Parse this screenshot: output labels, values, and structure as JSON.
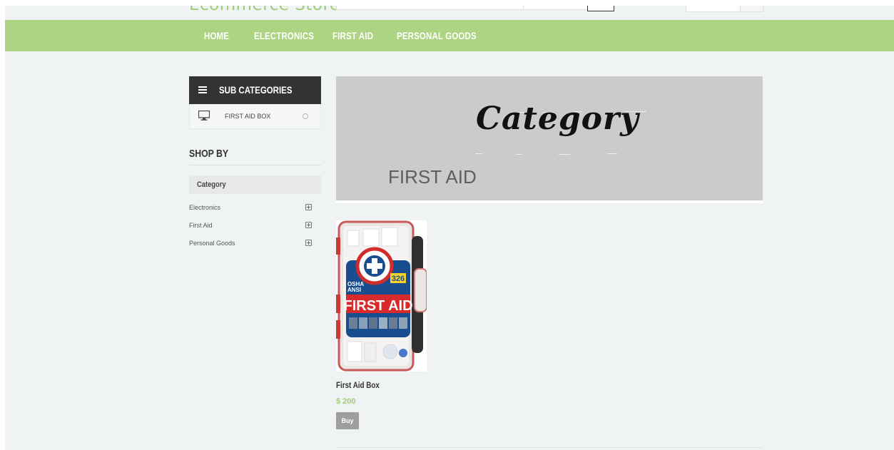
{
  "header": {
    "logo": "Ecommerce Store"
  },
  "nav": {
    "items": [
      {
        "label": "HOME"
      },
      {
        "label": "ELECTRONICS"
      },
      {
        "label": "FIRST AID"
      },
      {
        "label": "PERSONAL GOODS"
      }
    ]
  },
  "sidebar": {
    "subcategories_title": "SUB CATEGORIES",
    "subcategory": {
      "label": "FIRST AID BOX",
      "icon": "monitor-icon"
    },
    "shop_by": "SHOP BY",
    "category_label": "Category",
    "categories": [
      {
        "label": "Electronics"
      },
      {
        "label": "First Aid"
      },
      {
        "label": "Personal Goods"
      }
    ]
  },
  "banner": {
    "script_title": "Category",
    "category_name": "FIRST AID"
  },
  "product": {
    "name": "First Aid Box",
    "price": "$ 200",
    "buy_label": "Buy",
    "image_text": {
      "count": "326",
      "badge_left": "OSHA",
      "badge_left2": "ANSI",
      "title": "FIRST AID"
    }
  },
  "colors": {
    "nav_bg": "#acd482",
    "accent_green": "#9fcc78",
    "dark_header": "#333333",
    "banner_bg": "#cbcbcb",
    "page_bg": "#f0f3f4"
  }
}
